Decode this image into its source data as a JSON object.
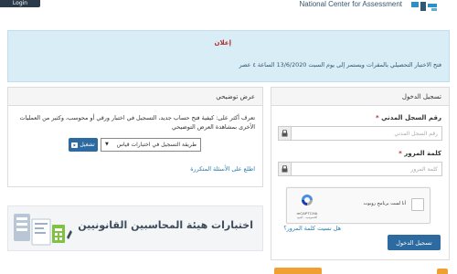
{
  "header": {
    "login_label": "Login",
    "org_name": "National Center for Assessment",
    "logo_icon": "qiyas-logo"
  },
  "announcement": {
    "title": "إعلان",
    "body": "فتح الاختبار التحصيلي بالمقرات ويستمر إلى يوم السبت 13/6/2020 الساعة ٤ عصر"
  },
  "login": {
    "heading": "تسجيل الدخول",
    "national_id_label": "رقم السجل المدني",
    "national_id_placeholder": "رقم السجل المدني",
    "password_label": "كلمة المرور",
    "password_placeholder": "كلمة المرور",
    "required_mark": "*",
    "captcha_text": "أنا لست برنامج روبوت",
    "captcha_brand": "reCAPTCHA",
    "captcha_privacy": "الخصوصية - البنود",
    "forgot_password": "هل نسيت كلمة المرور؟",
    "submit": "تسجيل الدخول"
  },
  "demo": {
    "heading": "عرض توضيحي",
    "description": "تعرف أكثر على: كيفية فتح حساب جديد، التسجيل في اختبار ورقي أو محوسب، وكثير من العمليات الأخرى بمشاهدة العرض التوضيحي",
    "select_value": "طريقة التسجيل في اختبارات قياس",
    "play_label": "تشغيل",
    "faq_link": "اطلع على الأسئلة المتكررة"
  },
  "banner": {
    "title": "اختبارات هيئة المحاسبين القانونيين"
  },
  "colors": {
    "accent": "#2d6aa0",
    "alert": "#b3302c",
    "announce_bg": "#d8edf6",
    "orange": "#f0a030"
  }
}
